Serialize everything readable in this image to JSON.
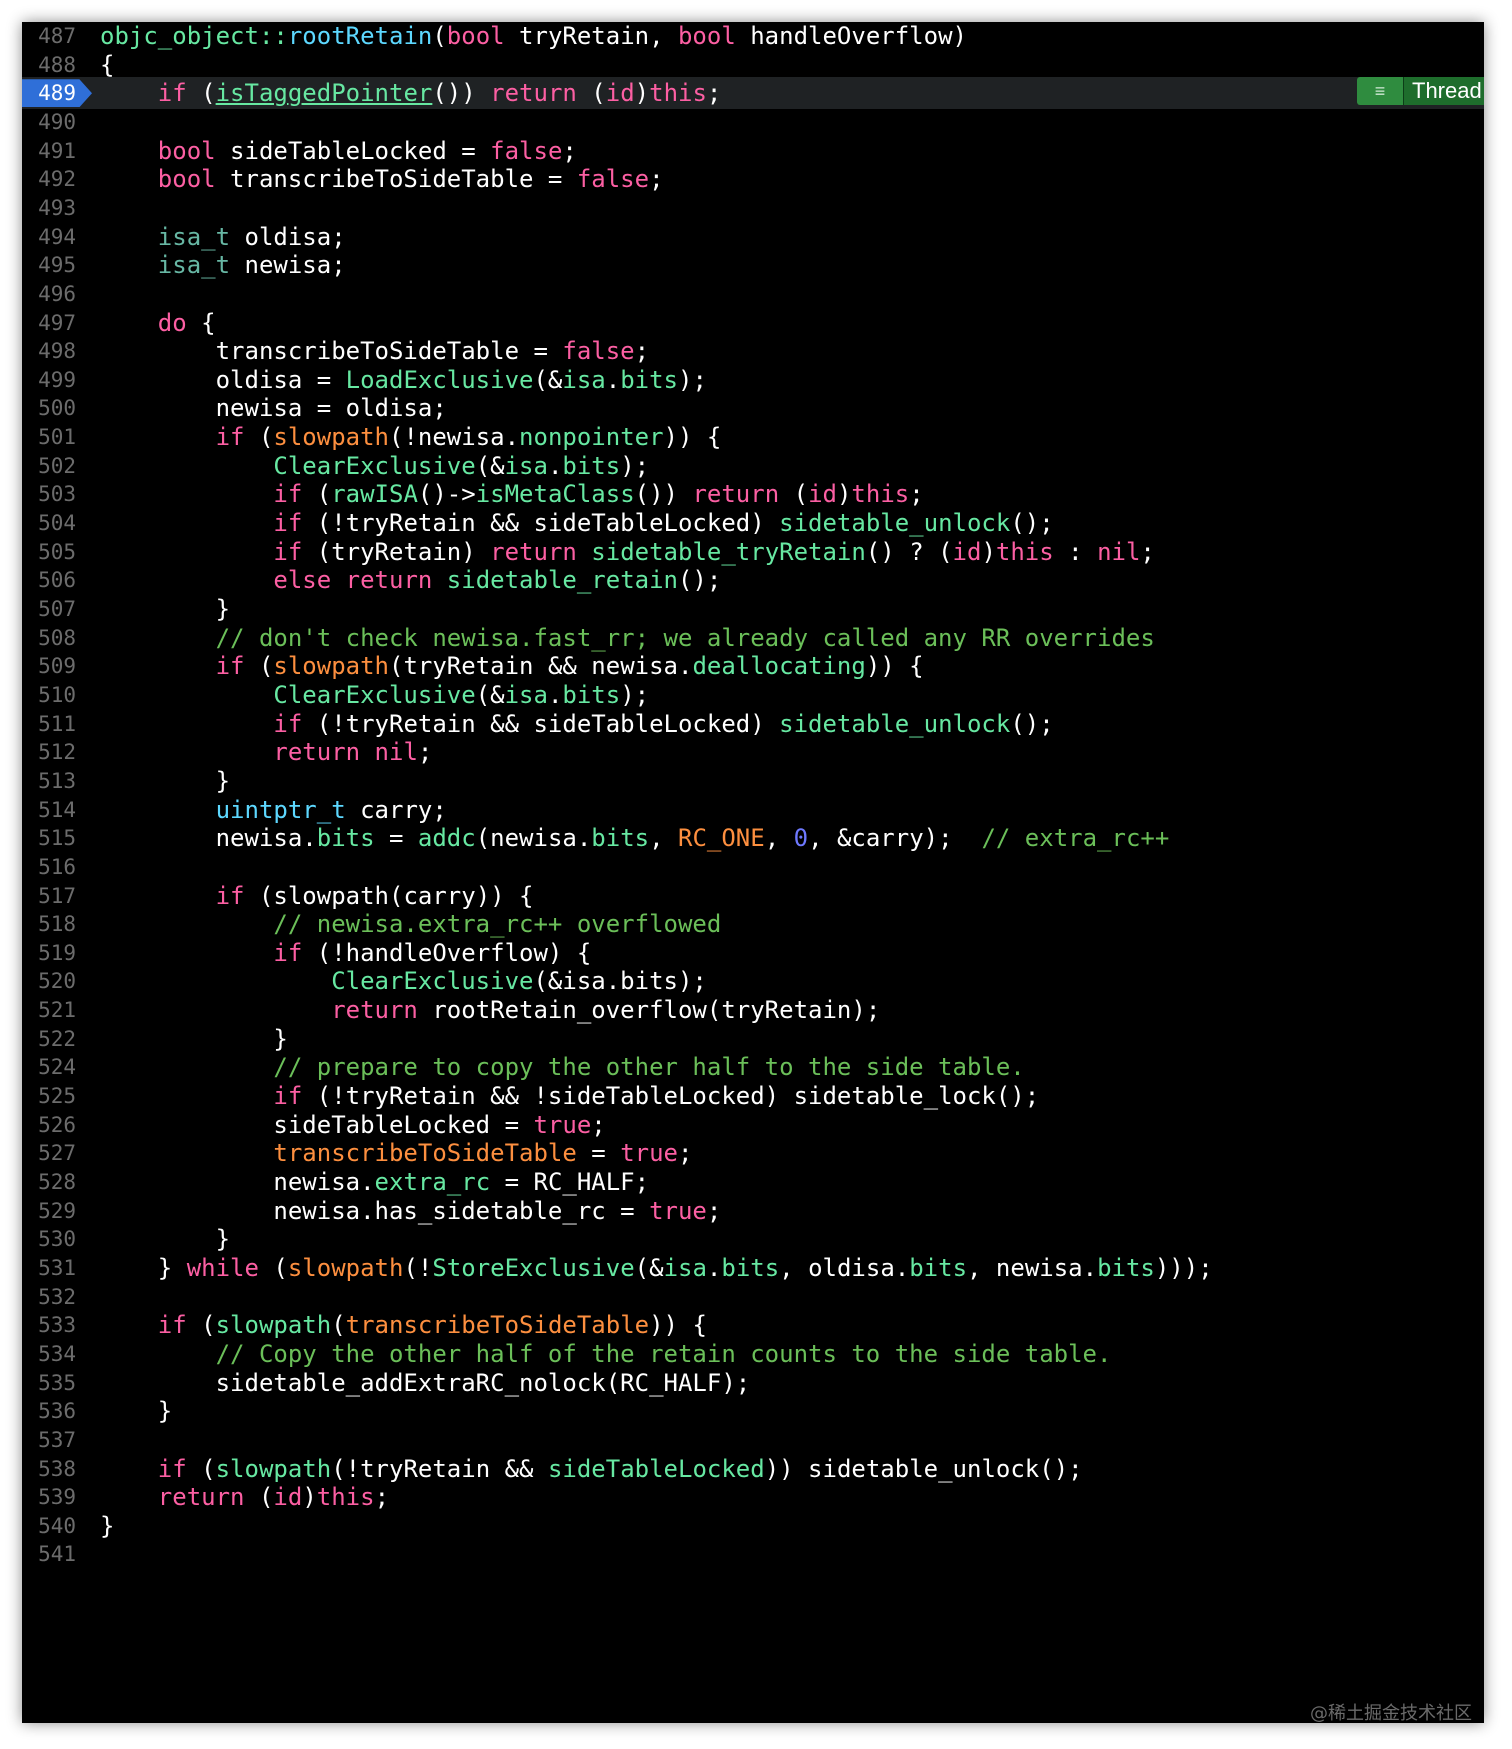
{
  "editor": {
    "current_line": "489",
    "thread_badge": {
      "icon": "list-icon",
      "label": "Thread"
    },
    "lines": [
      {
        "n": "487",
        "t": [
          [
            "objc_object::",
            "fn"
          ],
          [
            "rootRetain",
            "fn2"
          ],
          [
            "(",
            "plain"
          ],
          [
            "bool",
            "kw"
          ],
          [
            " tryRetain, ",
            "plain"
          ],
          [
            "bool",
            "kw"
          ],
          [
            " handleOverflow)",
            "plain"
          ]
        ]
      },
      {
        "n": "488",
        "t": [
          [
            "{",
            "plain"
          ]
        ]
      },
      {
        "n": "489",
        "t": [
          [
            "    ",
            "plain"
          ],
          [
            "if",
            "kw"
          ],
          [
            " (",
            "plain"
          ],
          [
            "isTaggedPointer",
            "link"
          ],
          [
            "()) ",
            "plain"
          ],
          [
            "return",
            "kw"
          ],
          [
            " (",
            "plain"
          ],
          [
            "id",
            "kw"
          ],
          [
            ")",
            "plain"
          ],
          [
            "this",
            "kw"
          ],
          [
            ";",
            "plain"
          ]
        ]
      },
      {
        "n": "490",
        "t": []
      },
      {
        "n": "491",
        "t": [
          [
            "    ",
            "plain"
          ],
          [
            "bool",
            "kw"
          ],
          [
            " sideTableLocked = ",
            "plain"
          ],
          [
            "false",
            "kw"
          ],
          [
            ";",
            "plain"
          ]
        ]
      },
      {
        "n": "492",
        "t": [
          [
            "    ",
            "plain"
          ],
          [
            "bool",
            "kw"
          ],
          [
            " transcribeToSideTable = ",
            "plain"
          ],
          [
            "false",
            "kw"
          ],
          [
            ";",
            "plain"
          ]
        ]
      },
      {
        "n": "493",
        "t": []
      },
      {
        "n": "494",
        "t": [
          [
            "    ",
            "plain"
          ],
          [
            "isa_t",
            "type"
          ],
          [
            " oldisa;",
            "plain"
          ]
        ]
      },
      {
        "n": "495",
        "t": [
          [
            "    ",
            "plain"
          ],
          [
            "isa_t",
            "type"
          ],
          [
            " newisa;",
            "plain"
          ]
        ]
      },
      {
        "n": "496",
        "t": []
      },
      {
        "n": "497",
        "t": [
          [
            "    ",
            "plain"
          ],
          [
            "do",
            "kw"
          ],
          [
            " {",
            "plain"
          ]
        ]
      },
      {
        "n": "498",
        "t": [
          [
            "        transcribeToSideTable = ",
            "plain"
          ],
          [
            "false",
            "kw"
          ],
          [
            ";",
            "plain"
          ]
        ]
      },
      {
        "n": "499",
        "t": [
          [
            "        oldisa = ",
            "plain"
          ],
          [
            "LoadExclusive",
            "fn"
          ],
          [
            "(&",
            "plain"
          ],
          [
            "isa",
            "fn"
          ],
          [
            ".",
            "plain"
          ],
          [
            "bits",
            "fn"
          ],
          [
            ");",
            "plain"
          ]
        ]
      },
      {
        "n": "500",
        "t": [
          [
            "        newisa = oldisa;",
            "plain"
          ]
        ]
      },
      {
        "n": "501",
        "t": [
          [
            "        ",
            "plain"
          ],
          [
            "if",
            "kw"
          ],
          [
            " (",
            "plain"
          ],
          [
            "slowpath",
            "mac"
          ],
          [
            "(!newisa.",
            "plain"
          ],
          [
            "nonpointer",
            "fn"
          ],
          [
            ")) {",
            "plain"
          ]
        ]
      },
      {
        "n": "502",
        "t": [
          [
            "            ",
            "plain"
          ],
          [
            "ClearExclusive",
            "fn"
          ],
          [
            "(&",
            "plain"
          ],
          [
            "isa",
            "fn"
          ],
          [
            ".",
            "plain"
          ],
          [
            "bits",
            "fn"
          ],
          [
            ");",
            "plain"
          ]
        ]
      },
      {
        "n": "503",
        "t": [
          [
            "            ",
            "plain"
          ],
          [
            "if",
            "kw"
          ],
          [
            " (",
            "plain"
          ],
          [
            "rawISA",
            "fn"
          ],
          [
            "()->",
            "plain"
          ],
          [
            "isMetaClass",
            "fn"
          ],
          [
            "()) ",
            "plain"
          ],
          [
            "return",
            "kw"
          ],
          [
            " (",
            "plain"
          ],
          [
            "id",
            "kw"
          ],
          [
            ")",
            "plain"
          ],
          [
            "this",
            "kw"
          ],
          [
            ";",
            "plain"
          ]
        ]
      },
      {
        "n": "504",
        "t": [
          [
            "            ",
            "plain"
          ],
          [
            "if",
            "kw"
          ],
          [
            " (!tryRetain && sideTableLocked) ",
            "plain"
          ],
          [
            "sidetable_unlock",
            "fn"
          ],
          [
            "();",
            "plain"
          ]
        ]
      },
      {
        "n": "505",
        "t": [
          [
            "            ",
            "plain"
          ],
          [
            "if",
            "kw"
          ],
          [
            " (tryRetain) ",
            "plain"
          ],
          [
            "return",
            "kw"
          ],
          [
            " ",
            "plain"
          ],
          [
            "sidetable_tryRetain",
            "fn"
          ],
          [
            "() ? (",
            "plain"
          ],
          [
            "id",
            "kw"
          ],
          [
            ")",
            "plain"
          ],
          [
            "this",
            "kw"
          ],
          [
            " : ",
            "plain"
          ],
          [
            "nil",
            "kw"
          ],
          [
            ";",
            "plain"
          ]
        ]
      },
      {
        "n": "506",
        "t": [
          [
            "            ",
            "plain"
          ],
          [
            "else",
            "kw"
          ],
          [
            " ",
            "plain"
          ],
          [
            "return",
            "kw"
          ],
          [
            " ",
            "plain"
          ],
          [
            "sidetable_retain",
            "fn"
          ],
          [
            "();",
            "plain"
          ]
        ]
      },
      {
        "n": "507",
        "t": [
          [
            "        }",
            "plain"
          ]
        ]
      },
      {
        "n": "508",
        "t": [
          [
            "        ",
            "plain"
          ],
          [
            "// don't check newisa.fast_rr; we already called any RR overrides",
            "cm"
          ]
        ]
      },
      {
        "n": "509",
        "t": [
          [
            "        ",
            "plain"
          ],
          [
            "if",
            "kw"
          ],
          [
            " (",
            "plain"
          ],
          [
            "slowpath",
            "mac"
          ],
          [
            "(tryRetain && newisa.",
            "plain"
          ],
          [
            "deallocating",
            "fn"
          ],
          [
            ")) {",
            "plain"
          ]
        ]
      },
      {
        "n": "510",
        "t": [
          [
            "            ",
            "plain"
          ],
          [
            "ClearExclusive",
            "fn"
          ],
          [
            "(&",
            "plain"
          ],
          [
            "isa",
            "fn"
          ],
          [
            ".",
            "plain"
          ],
          [
            "bits",
            "fn"
          ],
          [
            ");",
            "plain"
          ]
        ]
      },
      {
        "n": "511",
        "t": [
          [
            "            ",
            "plain"
          ],
          [
            "if",
            "kw"
          ],
          [
            " (!tryRetain && sideTableLocked) ",
            "plain"
          ],
          [
            "sidetable_unlock",
            "fn"
          ],
          [
            "();",
            "plain"
          ]
        ]
      },
      {
        "n": "512",
        "t": [
          [
            "            ",
            "plain"
          ],
          [
            "return",
            "kw"
          ],
          [
            " ",
            "plain"
          ],
          [
            "nil",
            "kw"
          ],
          [
            ";",
            "plain"
          ]
        ]
      },
      {
        "n": "513",
        "t": [
          [
            "        }",
            "plain"
          ]
        ]
      },
      {
        "n": "514",
        "t": [
          [
            "        ",
            "plain"
          ],
          [
            "uintptr_t",
            "fn2"
          ],
          [
            " carry;",
            "plain"
          ]
        ]
      },
      {
        "n": "515",
        "t": [
          [
            "        newisa.",
            "plain"
          ],
          [
            "bits",
            "fn"
          ],
          [
            " = ",
            "plain"
          ],
          [
            "addc",
            "fn"
          ],
          [
            "(newisa.",
            "plain"
          ],
          [
            "bits",
            "fn"
          ],
          [
            ", ",
            "plain"
          ],
          [
            "RC_ONE",
            "mac"
          ],
          [
            ", ",
            "plain"
          ],
          [
            "0",
            "num2"
          ],
          [
            ", &carry);  ",
            "plain"
          ],
          [
            "// extra_rc++",
            "cm"
          ]
        ]
      },
      {
        "n": "516",
        "t": []
      },
      {
        "n": "517",
        "t": [
          [
            "        ",
            "plain"
          ],
          [
            "if",
            "kw"
          ],
          [
            " (slowpath(carry)) {",
            "plain"
          ]
        ]
      },
      {
        "n": "518",
        "t": [
          [
            "            ",
            "plain"
          ],
          [
            "// newisa.extra_rc++ overflowed",
            "cm"
          ]
        ]
      },
      {
        "n": "519",
        "t": [
          [
            "            ",
            "plain"
          ],
          [
            "if",
            "kw"
          ],
          [
            " (!handleOverflow) {",
            "plain"
          ]
        ]
      },
      {
        "n": "520",
        "t": [
          [
            "                ",
            "plain"
          ],
          [
            "ClearExclusive",
            "fn"
          ],
          [
            "(&isa.bits);",
            "plain"
          ]
        ]
      },
      {
        "n": "521",
        "t": [
          [
            "                ",
            "plain"
          ],
          [
            "return",
            "kw"
          ],
          [
            " rootRetain_overflow(tryRetain);",
            "plain"
          ]
        ]
      },
      {
        "n": "522",
        "t": [
          [
            "            }",
            "plain"
          ]
        ]
      },
      {
        "n": "524",
        "t": [
          [
            "            ",
            "plain"
          ],
          [
            "// prepare to copy the other half to the side table.",
            "cm"
          ]
        ]
      },
      {
        "n": "525",
        "t": [
          [
            "            ",
            "plain"
          ],
          [
            "if",
            "kw"
          ],
          [
            " (!tryRetain && !sideTableLocked) sidetable_lock();",
            "plain"
          ]
        ]
      },
      {
        "n": "526",
        "t": [
          [
            "            sideTableLocked = ",
            "plain"
          ],
          [
            "true",
            "kw"
          ],
          [
            ";",
            "plain"
          ]
        ]
      },
      {
        "n": "527",
        "t": [
          [
            "            ",
            "plain"
          ],
          [
            "transcribeToSideTable",
            "mac"
          ],
          [
            " = ",
            "plain"
          ],
          [
            "true",
            "kw"
          ],
          [
            ";",
            "plain"
          ]
        ]
      },
      {
        "n": "528",
        "t": [
          [
            "            newisa.",
            "plain"
          ],
          [
            "extra_rc",
            "fn"
          ],
          [
            " = RC_HALF;",
            "plain"
          ]
        ]
      },
      {
        "n": "529",
        "t": [
          [
            "            newisa.has_sidetable_rc = ",
            "plain"
          ],
          [
            "true",
            "kw"
          ],
          [
            ";",
            "plain"
          ]
        ]
      },
      {
        "n": "530",
        "t": [
          [
            "        }",
            "plain"
          ]
        ]
      },
      {
        "n": "531",
        "t": [
          [
            "    } ",
            "plain"
          ],
          [
            "while",
            "kw"
          ],
          [
            " (",
            "plain"
          ],
          [
            "slowpath",
            "mac"
          ],
          [
            "(!",
            "plain"
          ],
          [
            "StoreExclusive",
            "fn"
          ],
          [
            "(&",
            "plain"
          ],
          [
            "isa",
            "fn"
          ],
          [
            ".",
            "plain"
          ],
          [
            "bits",
            "fn"
          ],
          [
            ", oldisa.",
            "plain"
          ],
          [
            "bits",
            "fn"
          ],
          [
            ", newisa.",
            "plain"
          ],
          [
            "bits",
            "fn"
          ],
          [
            ")));",
            "plain"
          ]
        ]
      },
      {
        "n": "532",
        "t": []
      },
      {
        "n": "533",
        "t": [
          [
            "    ",
            "plain"
          ],
          [
            "if",
            "kw"
          ],
          [
            " (",
            "plain"
          ],
          [
            "slowpath",
            "fn"
          ],
          [
            "(",
            "plain"
          ],
          [
            "transcribeToSideTable",
            "mac"
          ],
          [
            ")) {",
            "plain"
          ]
        ]
      },
      {
        "n": "534",
        "t": [
          [
            "        ",
            "plain"
          ],
          [
            "// Copy the other half of the retain counts to the side table.",
            "cm"
          ]
        ]
      },
      {
        "n": "535",
        "t": [
          [
            "        sidetable_addExtraRC_nolock(RC_HALF);",
            "plain"
          ]
        ]
      },
      {
        "n": "536",
        "t": [
          [
            "    }",
            "plain"
          ]
        ]
      },
      {
        "n": "537",
        "t": []
      },
      {
        "n": "538",
        "t": [
          [
            "    ",
            "plain"
          ],
          [
            "if",
            "kw"
          ],
          [
            " (",
            "plain"
          ],
          [
            "slowpath",
            "fn"
          ],
          [
            "(!tryRetain && ",
            "plain"
          ],
          [
            "sideTableLocked",
            "fn"
          ],
          [
            ")) sidetable_unlock();",
            "plain"
          ]
        ]
      },
      {
        "n": "539",
        "t": [
          [
            "    ",
            "plain"
          ],
          [
            "return",
            "kw"
          ],
          [
            " (",
            "plain"
          ],
          [
            "id",
            "kw"
          ],
          [
            ")",
            "plain"
          ],
          [
            "this",
            "kw"
          ],
          [
            ";",
            "plain"
          ]
        ]
      },
      {
        "n": "540",
        "t": [
          [
            "}",
            "plain"
          ]
        ]
      },
      {
        "n": "541",
        "t": []
      }
    ]
  },
  "watermark": "@稀土掘金技术社区"
}
